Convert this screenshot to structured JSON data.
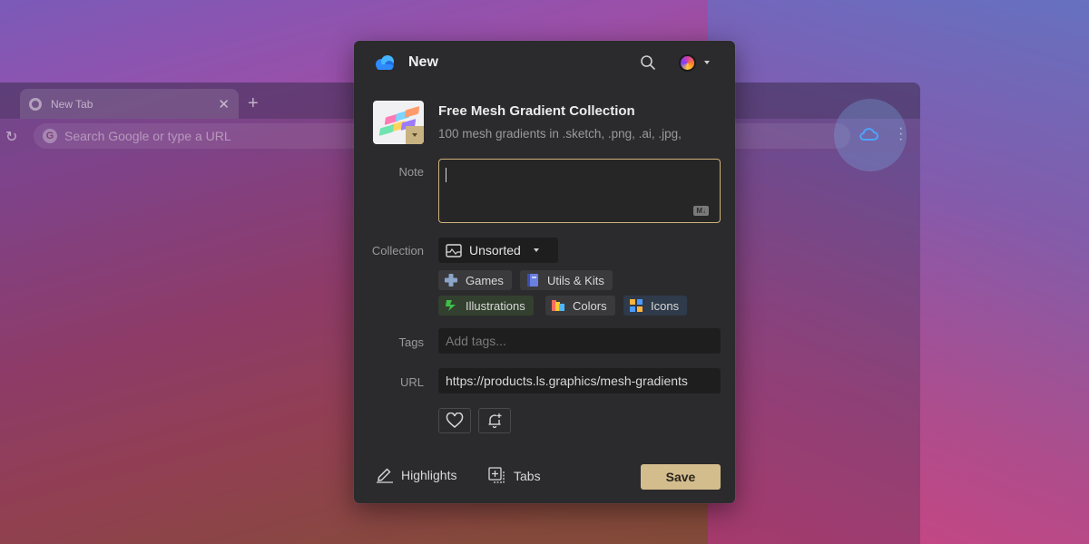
{
  "browser": {
    "tab_title": "New Tab",
    "omnibox_placeholder": "Search Google or type a URL"
  },
  "popup": {
    "header_title": "New",
    "item": {
      "title": "Free Mesh Gradient Collection",
      "description": "100 mesh gradients in .sketch, .png, .ai, .jpg,"
    },
    "labels": {
      "note": "Note",
      "collection": "Collection",
      "tags": "Tags",
      "url": "URL"
    },
    "note_value": "",
    "collection": {
      "selected": "Unsorted",
      "suggestions": [
        {
          "label": "Games",
          "icon": "plus-cross-icon"
        },
        {
          "label": "Utils & Kits",
          "icon": "book-icon"
        },
        {
          "label": "Illustrations",
          "icon": "puzzle-icon"
        },
        {
          "label": "Colors",
          "icon": "palette-icon"
        },
        {
          "label": "Icons",
          "icon": "grid-icon"
        }
      ]
    },
    "tags_placeholder": "Add tags...",
    "url_value": "https://products.ls.graphics/mesh-gradients",
    "footer": {
      "highlights": "Highlights",
      "tabs": "Tabs",
      "save": "Save"
    }
  },
  "colors": {
    "accent": "#d4bd8c",
    "popup_bg": "#2b2b2d",
    "input_bg": "#1e1e1f",
    "focus_border": "#cfb27a"
  }
}
